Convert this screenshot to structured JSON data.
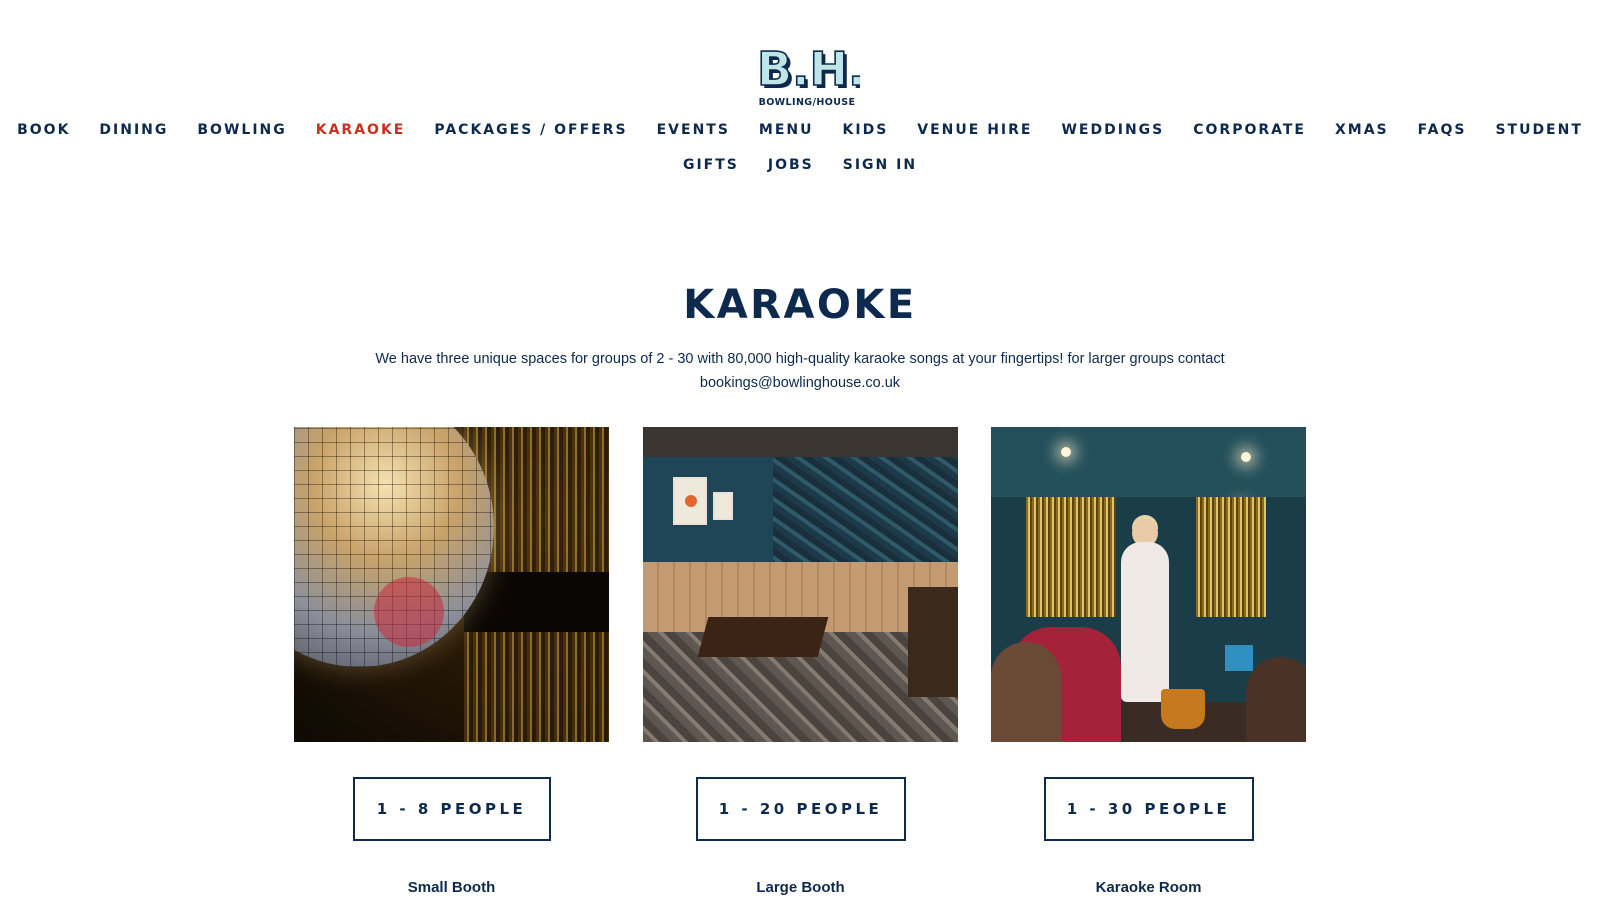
{
  "brand": {
    "logo_letters": "B.H.",
    "logo_text": "BOWLING/HOUSE"
  },
  "nav": {
    "row1": [
      "BOOK",
      "DINING",
      "BOWLING",
      "KARAOKE",
      "PACKAGES / OFFERS",
      "EVENTS",
      "MENU",
      "KIDS",
      "VENUE HIRE",
      "WEDDINGS",
      "CORPORATE",
      "XMAS",
      "FAQS",
      "STUDENT"
    ],
    "row2": [
      "GIFTS",
      "JOBS",
      "SIGN IN"
    ],
    "active": "KARAOKE"
  },
  "colors": {
    "navy": "#0d2a4e",
    "active_red": "#c7321f",
    "background": "#ffffff"
  },
  "main": {
    "title": "KARAOKE",
    "intro": "We have three unique spaces for groups of 2 - 30 with 80,000 high-quality karaoke songs at your fingertips! for larger groups contact bookings@bowlinghouse.co.uk"
  },
  "cards": [
    {
      "button": "1 - 8 PEOPLE",
      "name": "Small Booth",
      "photo_icon": "disco-ball-photo"
    },
    {
      "button": "1 - 20 PEOPLE",
      "name": "Large Booth",
      "photo_icon": "booth-room-photo"
    },
    {
      "button": "1 - 30 PEOPLE",
      "name": "Karaoke Room",
      "photo_icon": "karaoke-room-photo"
    }
  ]
}
